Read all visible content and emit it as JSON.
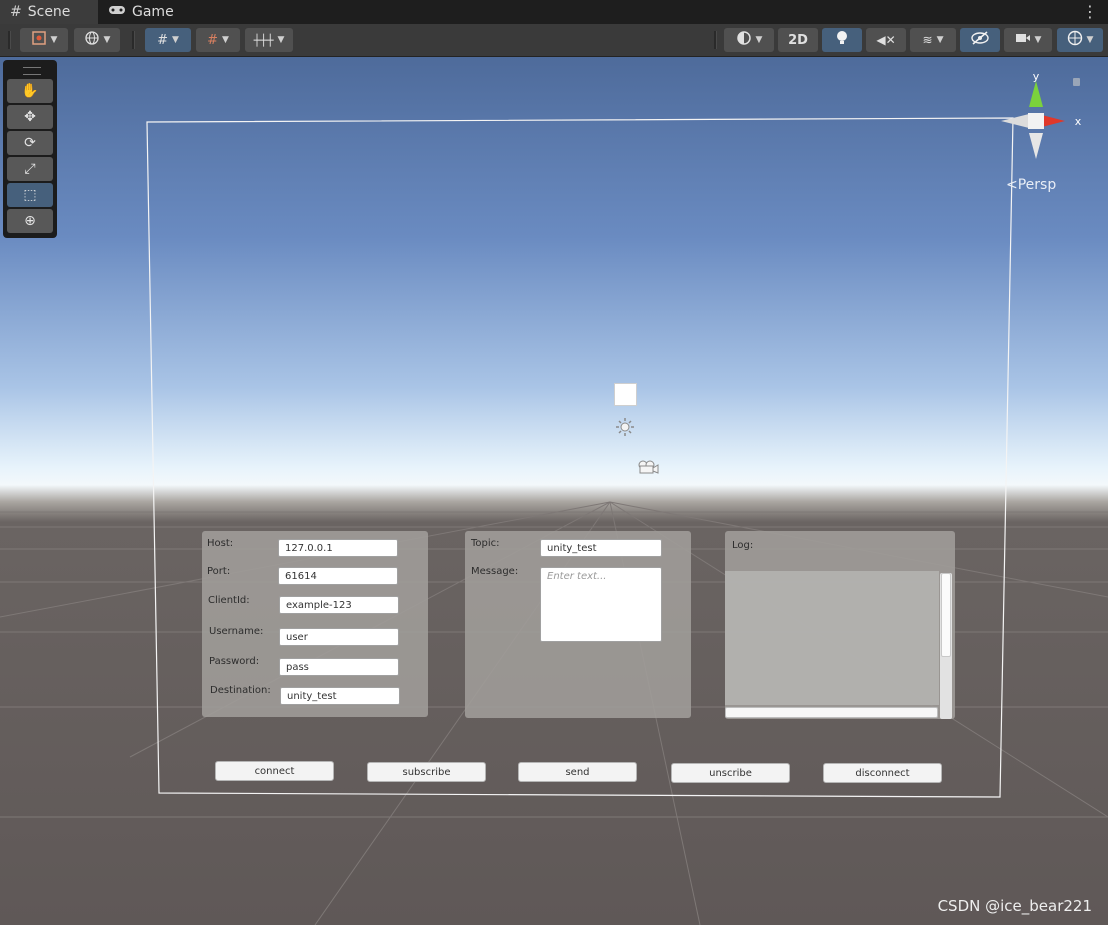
{
  "tabs": [
    {
      "label": "Scene",
      "icon": "grid-icon"
    },
    {
      "label": "Game",
      "icon": "gamepad-icon"
    }
  ],
  "toolbar": {
    "mode_2d_label": "2D"
  },
  "gizmo": {
    "y_label": "y",
    "x_label": "x",
    "projection_label": "Persp"
  },
  "connection_panel": {
    "fields": [
      {
        "label": "Host:",
        "value": "127.0.0.1"
      },
      {
        "label": "Port:",
        "value": "61614"
      },
      {
        "label": "ClientId:",
        "value": "example-123"
      },
      {
        "label": "Username:",
        "value": "user"
      },
      {
        "label": "Password:",
        "value": "pass"
      },
      {
        "label": "Destination:",
        "value": "unity_test"
      }
    ]
  },
  "message_panel": {
    "topic_label": "Topic:",
    "topic_value": "unity_test",
    "message_label": "Message:",
    "message_placeholder": "Enter text..."
  },
  "log_panel": {
    "label": "Log:"
  },
  "buttons": [
    "connect",
    "subscribe",
    "send",
    "unscribe",
    "disconnect"
  ],
  "watermark": "CSDN @ice_bear221",
  "colors": {
    "toolbar_active": "#46607c",
    "axis_y": "#7bd13c",
    "axis_x": "#e0382a"
  }
}
